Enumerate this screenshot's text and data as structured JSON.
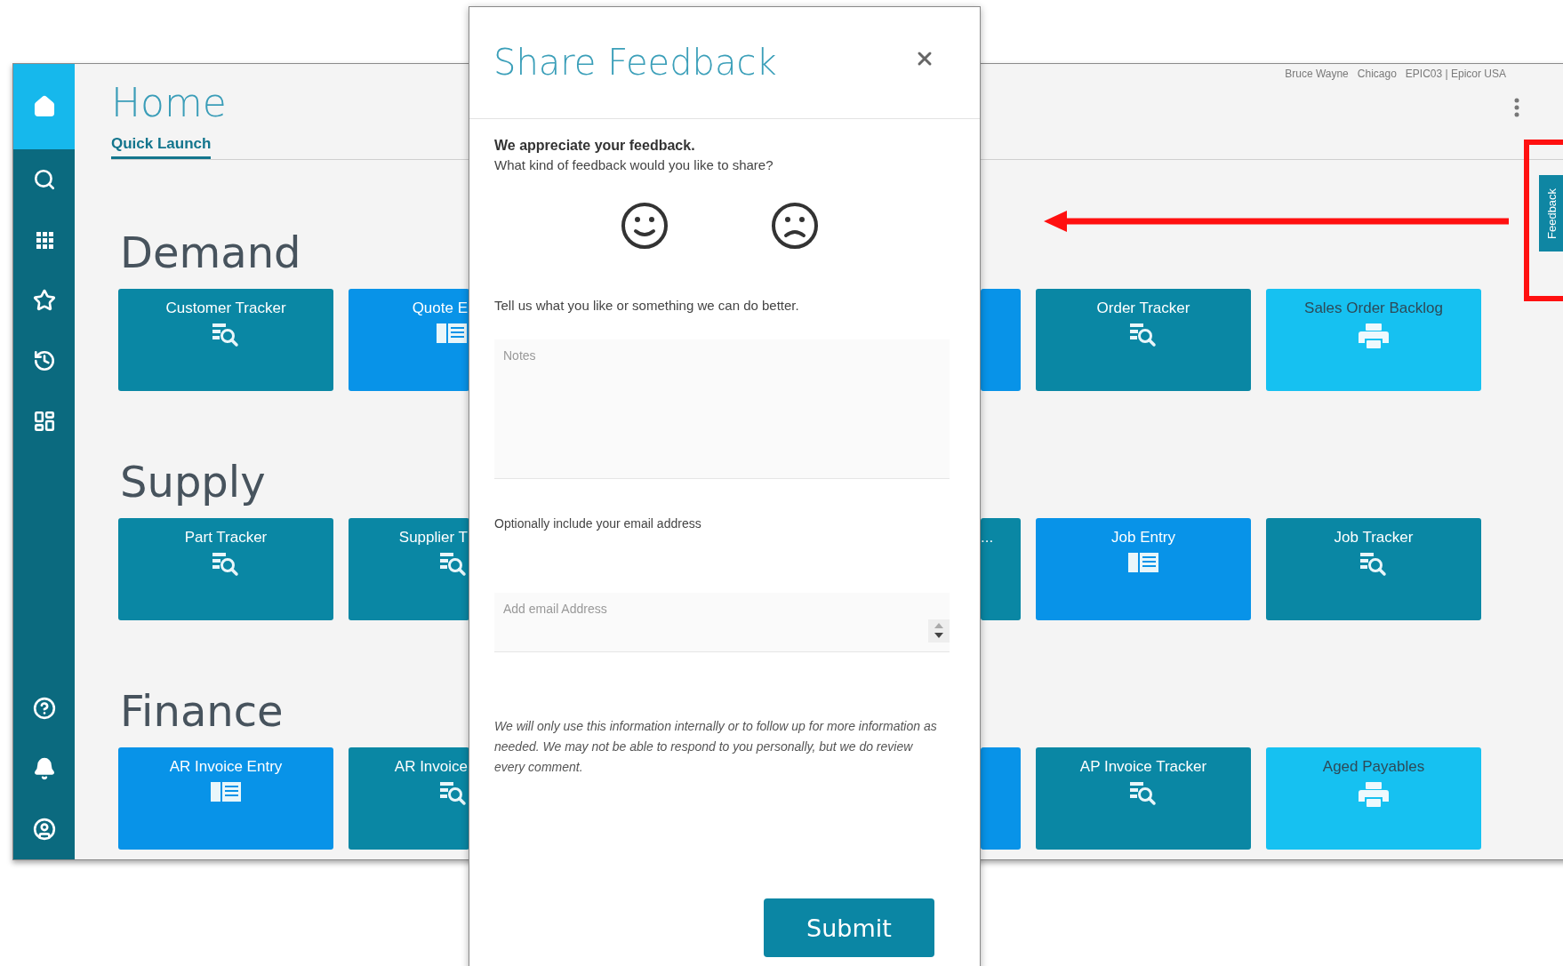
{
  "app": {
    "sidebar": {
      "items": [
        {
          "kind": "home",
          "selected": true
        },
        {
          "kind": "search",
          "selected": false
        },
        {
          "kind": "apps",
          "selected": false
        },
        {
          "kind": "favorites",
          "selected": false
        },
        {
          "kind": "history",
          "selected": false
        },
        {
          "kind": "dashboard",
          "selected": false
        }
      ],
      "bottom_items": [
        {
          "kind": "help",
          "selected": false
        },
        {
          "kind": "notifications",
          "selected": false
        },
        {
          "kind": "account",
          "selected": false
        }
      ]
    },
    "header": {
      "user": "Bruce Wayne",
      "site": "Chicago",
      "company": "EPIC03 | Epicor USA"
    },
    "title": "Home",
    "tabs": [
      {
        "label": "Quick Launch",
        "selected": true
      }
    ],
    "sections": [
      {
        "heading": "Demand",
        "tiles": [
          {
            "label": "Customer Tracker",
            "kind": "tracker",
            "hidden_right": false,
            "hidden_left": false
          },
          {
            "label": "Quote E",
            "kind": "entry",
            "hidden_right": true,
            "hidden_left": false
          },
          {
            "kind": "entry",
            "hidden_right": false,
            "hidden_left": true
          },
          {
            "label": "Order Tracker",
            "kind": "tracker",
            "hidden_right": false,
            "hidden_left": false
          },
          {
            "label": "Sales Order Backlog",
            "kind": "report",
            "hidden_right": false,
            "hidden_left": false
          }
        ]
      },
      {
        "heading": "Supply",
        "tiles": [
          {
            "label": "Part Tracker",
            "kind": "tracker",
            "hidden_right": false,
            "hidden_left": false
          },
          {
            "label": "Supplier T",
            "kind": "tracker",
            "hidden_right": true,
            "hidden_left": false
          },
          {
            "label": "...",
            "kind": "tracker",
            "hidden_right": false,
            "hidden_left": true
          },
          {
            "label": "Job Entry",
            "kind": "entry",
            "hidden_right": false,
            "hidden_left": false
          },
          {
            "label": "Job Tracker",
            "kind": "tracker",
            "hidden_right": false,
            "hidden_left": false
          }
        ]
      },
      {
        "heading": "Finance",
        "tiles": [
          {
            "label": "AR Invoice Entry",
            "kind": "entry",
            "hidden_right": false,
            "hidden_left": false
          },
          {
            "label": "AR Invoice",
            "kind": "tracker",
            "hidden_right": true,
            "hidden_left": false
          },
          {
            "kind": "entry",
            "hidden_right": false,
            "hidden_left": true
          },
          {
            "label": "AP Invoice Tracker",
            "kind": "tracker",
            "hidden_right": false,
            "hidden_left": false
          },
          {
            "label": "Aged Payables",
            "kind": "report",
            "hidden_right": false,
            "hidden_left": false
          }
        ]
      }
    ],
    "feedback_tab": {
      "label": "Feedback"
    }
  },
  "dialog": {
    "title": "Share Feedback",
    "intro": "We appreciate your feedback.",
    "question": "What kind of feedback would you like to share?",
    "options": [
      {
        "kind": "positive",
        "selected": false
      },
      {
        "kind": "negative",
        "selected": false
      }
    ],
    "prompt": "Tell us what you like or something we can do better.",
    "notes": {
      "placeholder": "Notes"
    },
    "email_label": "Optionally include your email address",
    "email": {
      "placeholder": "Add email Address"
    },
    "disclaimer": "We will only use this information internally or to follow up for more information as needed. We may not be able to respond to you personally, but we do review every comment.",
    "submit": "Submit"
  }
}
